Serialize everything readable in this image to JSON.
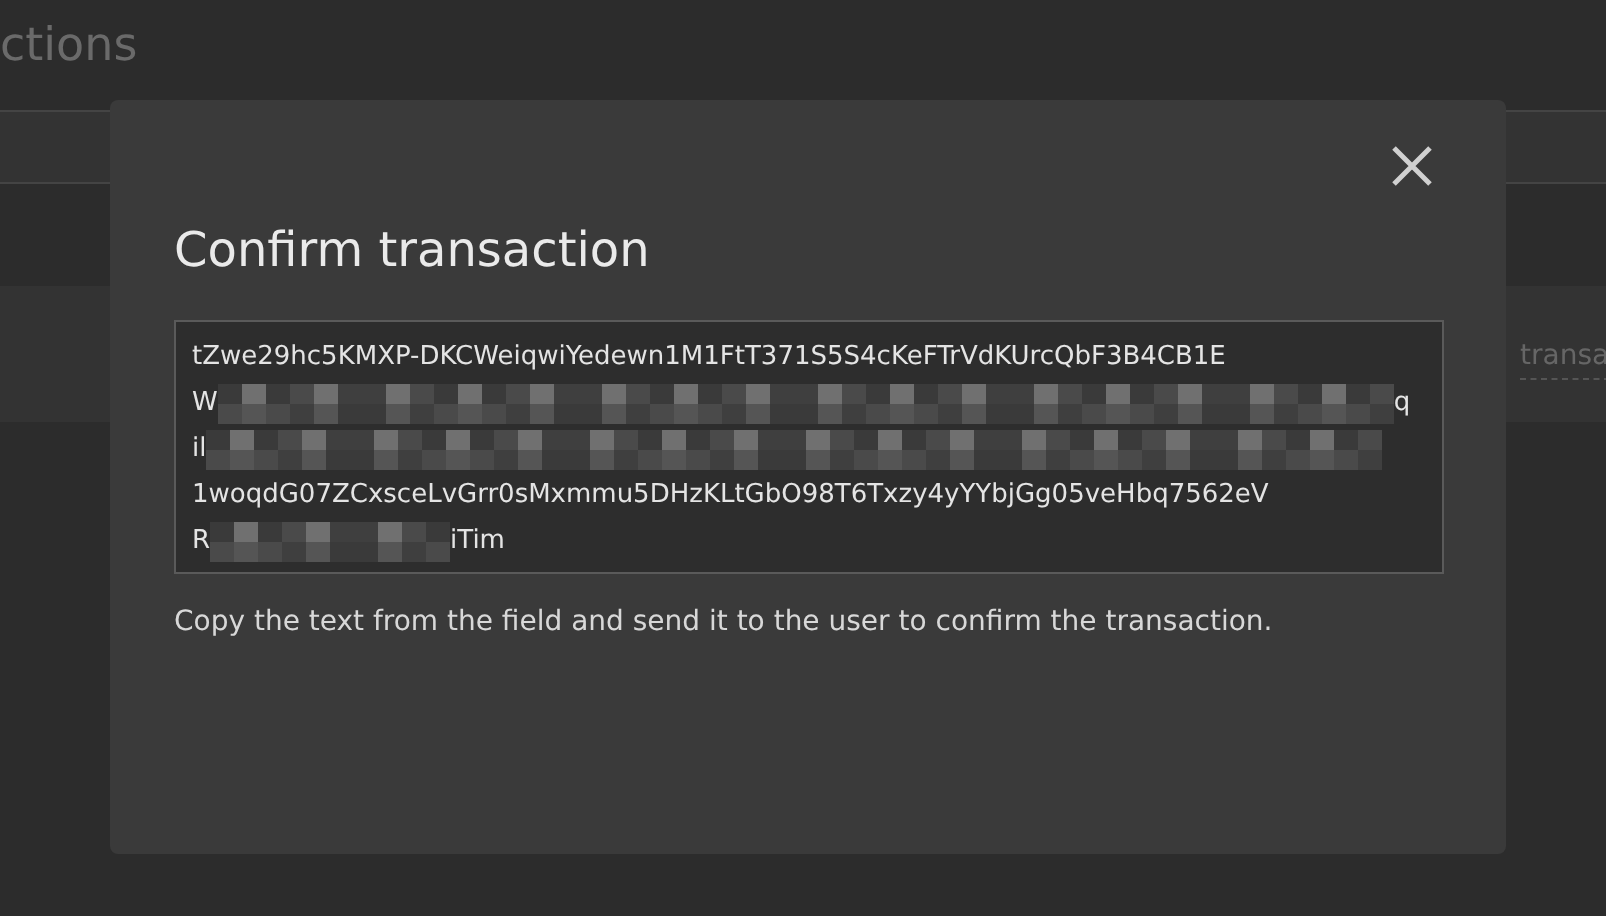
{
  "page": {
    "title": "ctions",
    "field_hint": "transa"
  },
  "dialog": {
    "title": "Confirm transaction",
    "lines": [
      {
        "kind": "text",
        "text": "tZwe29hc5KMXP-DKCWeiqwiYedewn1M1FtT371S5S4cKeFTrVdKUrcQbF3B4CB1E"
      },
      {
        "kind": "masked",
        "start": "W",
        "end": "q"
      },
      {
        "kind": "masked",
        "start": "il"
      },
      {
        "kind": "text",
        "text": "1woqdG07ZCxsceLvGrr0sMxmmu5DHzKLtGbO98T6Txzy4yYYbjGg05veHbq7562eV"
      },
      {
        "kind": "masked",
        "start": "R",
        "end": "iTim",
        "short": true
      }
    ],
    "help": "Copy the text from the field and send it to the user to confirm the transaction."
  }
}
